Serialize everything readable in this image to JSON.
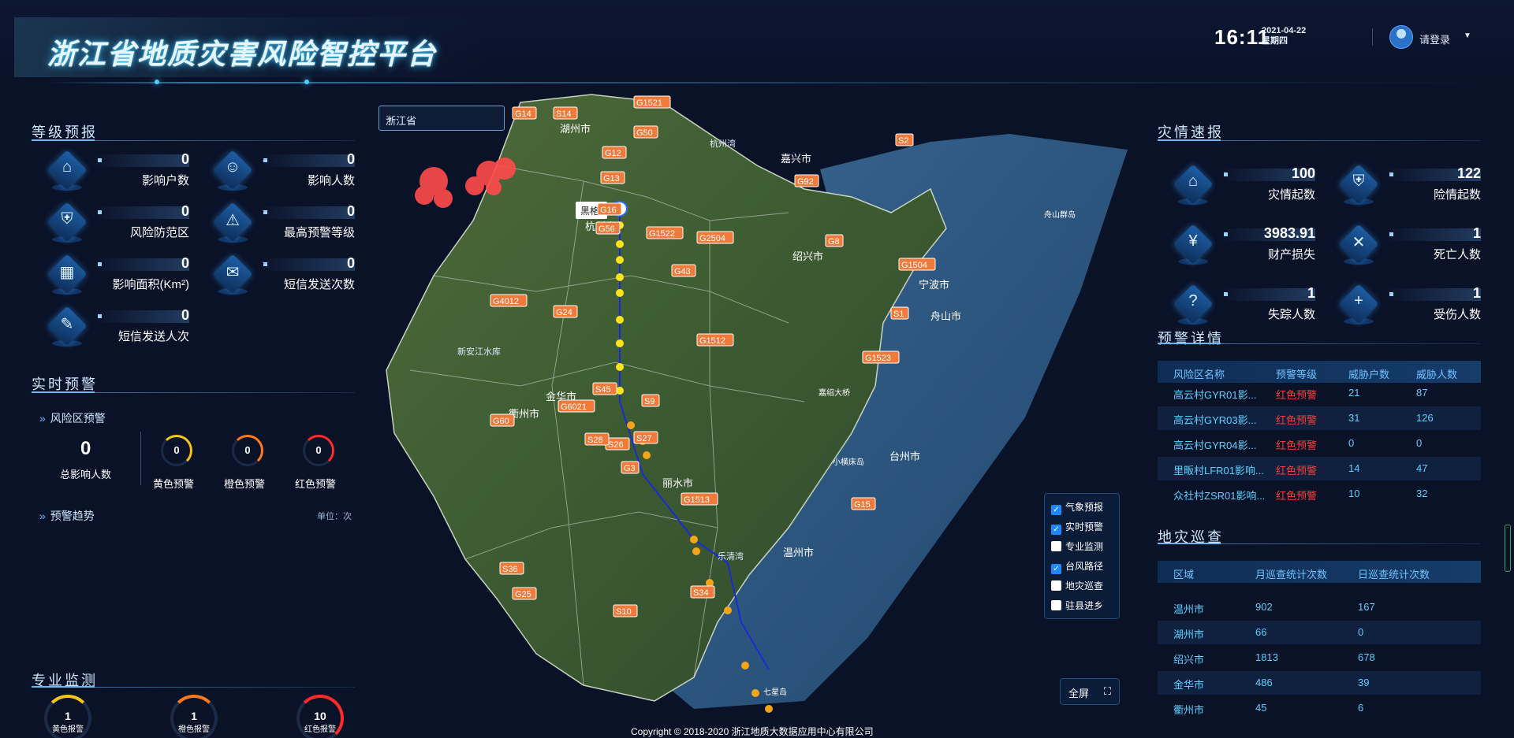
{
  "header": {
    "title": "浙江省地质灾害风险智控平台",
    "time": "16:11",
    "date": "2021-04-22",
    "weekday": "星期四",
    "login_label": "请登录"
  },
  "left": {
    "level_forecast": {
      "title": "等级预报",
      "stats": [
        {
          "icon": "house-icon",
          "value": "0",
          "label": "影响户数"
        },
        {
          "icon": "people-icon",
          "value": "0",
          "label": "影响人数"
        },
        {
          "icon": "shield-icon",
          "value": "0",
          "label": "风险防范区"
        },
        {
          "icon": "alarm-icon",
          "value": "0",
          "label": "最高预警等级"
        },
        {
          "icon": "area-icon",
          "value": "0",
          "label": "影响面积(Km²)"
        },
        {
          "icon": "mail-icon",
          "value": "0",
          "label": "短信发送次数"
        },
        {
          "icon": "sms-icon",
          "value": "0",
          "label": "短信发送人次"
        }
      ]
    },
    "realtime_warning": {
      "title": "实时预警",
      "sub1": "风险区预警",
      "total_value": "0",
      "total_label": "总影响人数",
      "rings": [
        {
          "value": "0",
          "label": "黄色预警",
          "color": "#f5c518"
        },
        {
          "value": "0",
          "label": "橙色预警",
          "color": "#ff7a1a"
        },
        {
          "value": "0",
          "label": "红色预警",
          "color": "#ff2a2a"
        }
      ],
      "sub2": "预警趋势",
      "unit": "单位：次"
    },
    "professional_monitor": {
      "title": "专业监测",
      "rings": [
        {
          "value": "1",
          "label": "黄色报警",
          "color": "#f5c518"
        },
        {
          "value": "1",
          "label": "橙色报警",
          "color": "#ff7a1a"
        },
        {
          "value": "10",
          "label": "红色报警",
          "color": "#ff2a2a"
        }
      ]
    }
  },
  "map": {
    "region_select": "浙江省",
    "typhoon_label": "黑格比",
    "cities": [
      "湖州市",
      "嘉兴市",
      "杭州市",
      "绍兴市",
      "宁波市",
      "舟山市",
      "金华市",
      "衢州市",
      "丽水市",
      "温州市",
      "台州市",
      "舟山群岛",
      "嘉绍大桥",
      "小横床岛",
      "七星岛"
    ],
    "sea_labels": [
      "杭州湾",
      "乐清湾",
      "新安江水库"
    ],
    "roads": [
      "G14",
      "G50",
      "G1521",
      "G12",
      "G13",
      "G92",
      "G16",
      "G1522",
      "G2504",
      "G8",
      "G56",
      "G1504",
      "G43",
      "G24",
      "G4012",
      "G1512",
      "G1523",
      "S45",
      "G6021",
      "S9",
      "S27",
      "G3",
      "G60",
      "S26",
      "S28",
      "G15",
      "G1513",
      "S36",
      "S34",
      "S10",
      "G25",
      "S2",
      "S1",
      "S14"
    ],
    "layers": [
      {
        "label": "气象预报",
        "checked": true
      },
      {
        "label": "实时预警",
        "checked": true
      },
      {
        "label": "专业监测",
        "checked": false
      },
      {
        "label": "台风路径",
        "checked": true
      },
      {
        "label": "地灾巡查",
        "checked": false
      },
      {
        "label": "驻县进乡",
        "checked": false
      }
    ],
    "fullscreen_label": "全屏"
  },
  "right": {
    "disaster_report": {
      "title": "灾情速报",
      "stats": [
        {
          "icon": "house-icon",
          "value": "100",
          "label": "灾情起数"
        },
        {
          "icon": "shield-icon",
          "value": "122",
          "label": "险情起数"
        },
        {
          "icon": "money-icon",
          "value": "3983.91",
          "label": "财产损失"
        },
        {
          "icon": "person-x-icon",
          "value": "1",
          "label": "死亡人数"
        },
        {
          "icon": "person-q-icon",
          "value": "1",
          "label": "失踪人数"
        },
        {
          "icon": "person-plus-icon",
          "value": "1",
          "label": "受伤人数"
        }
      ]
    },
    "warning_detail": {
      "title": "预警详情",
      "columns": [
        "风险区名称",
        "预警等级",
        "威胁户数",
        "威胁人数"
      ],
      "rows": [
        [
          "高云村GYR01影...",
          "红色预警",
          "21",
          "87"
        ],
        [
          "高云村GYR03影...",
          "红色预警",
          "31",
          "126"
        ],
        [
          "高云村GYR04影...",
          "红色预警",
          "0",
          "0"
        ],
        [
          "里畈村LFR01影响...",
          "红色预警",
          "14",
          "47"
        ],
        [
          "众社村ZSR01影响...",
          "红色预警",
          "10",
          "32"
        ]
      ]
    },
    "patrol": {
      "title": "地灾巡查",
      "columns": [
        "区域",
        "月巡查统计次数",
        "日巡查统计次数"
      ],
      "rows": [
        [
          "温州市",
          "902",
          "167"
        ],
        [
          "湖州市",
          "66",
          "0"
        ],
        [
          "绍兴市",
          "1813",
          "678"
        ],
        [
          "金华市",
          "486",
          "39"
        ],
        [
          "衢州市",
          "45",
          "6"
        ]
      ]
    }
  },
  "footer": {
    "copyright": "Copyright © 2018-2020 浙江地质大数据应用中心有限公司"
  }
}
